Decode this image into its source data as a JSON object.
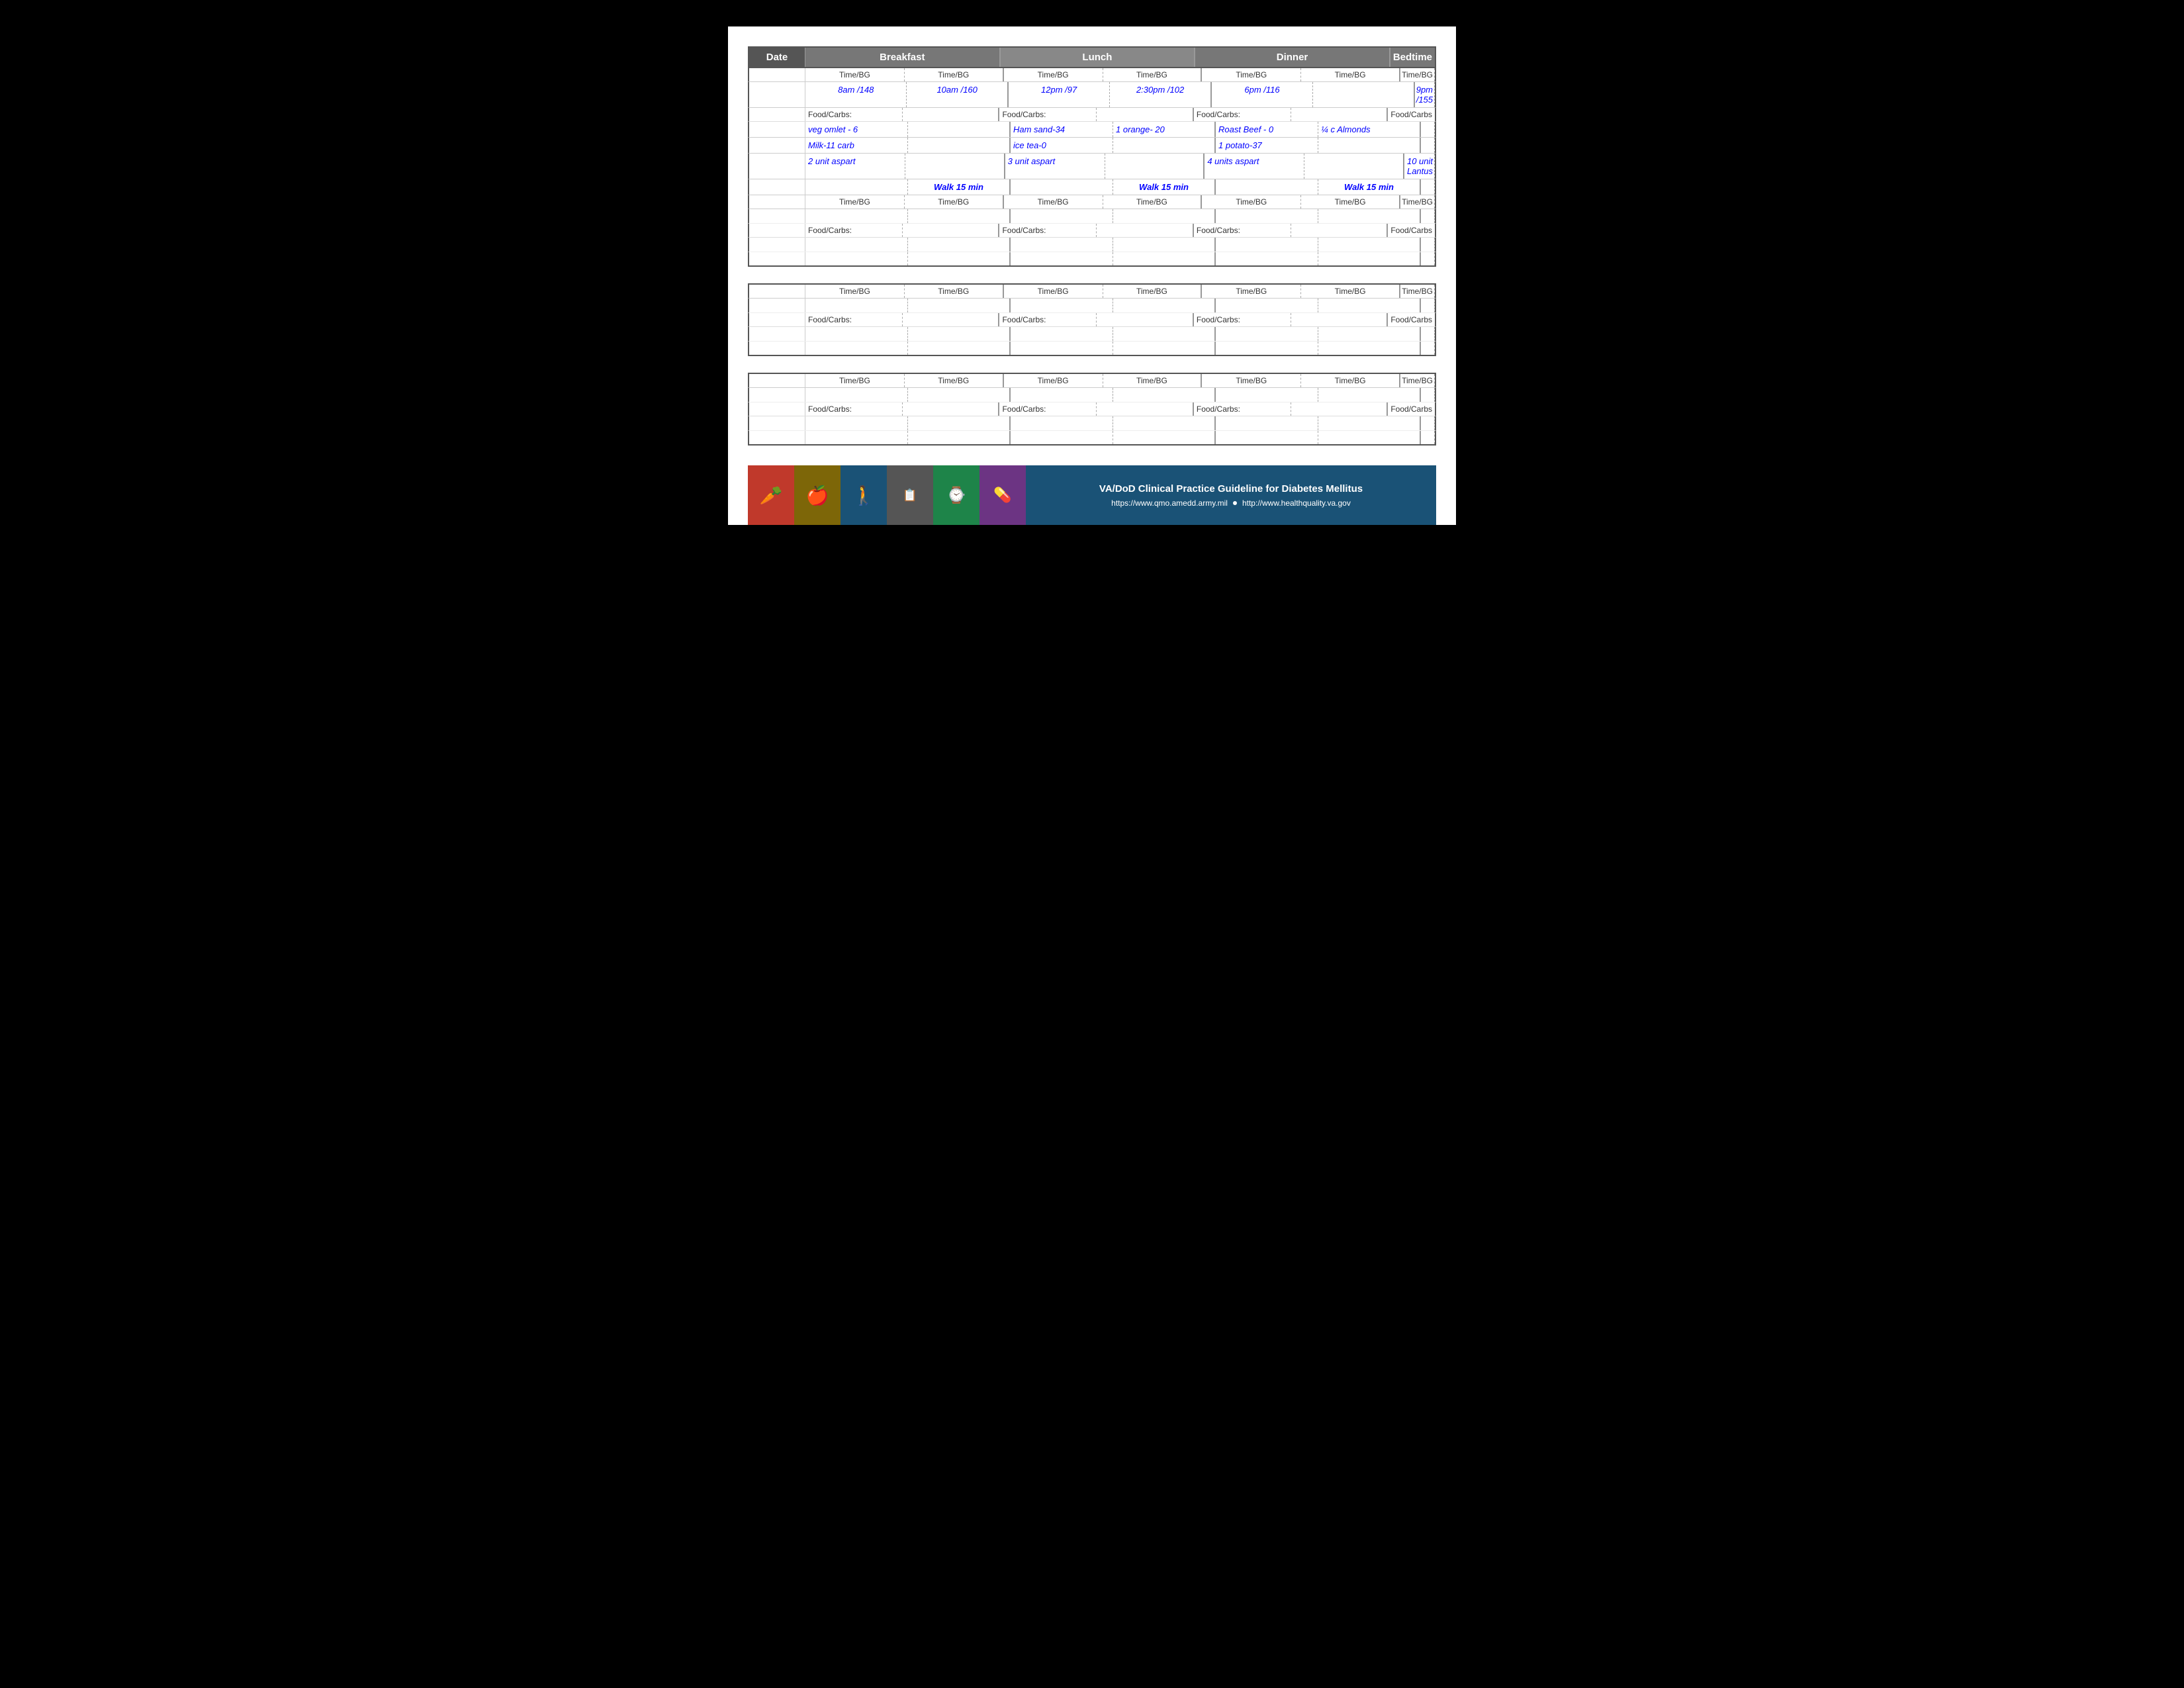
{
  "header": {
    "date_label": "Date",
    "breakfast_label": "Breakfast",
    "lunch_label": "Lunch",
    "dinner_label": "Dinner",
    "bedtime_label": "Bedtime"
  },
  "subheader": {
    "timebg": "Time/BG"
  },
  "row1": {
    "times": [
      "8am /148",
      "10am /160",
      "12pm /97",
      "2:30pm /102",
      "6pm /116",
      "",
      "9pm /155"
    ],
    "food_labels": [
      "Food/Carbs:",
      "",
      "Food/Carbs:",
      "",
      "Food/Carbs:",
      "",
      "Food/Carbs"
    ],
    "food_values": [
      "veg omlet - 6",
      "",
      "Ham sand-34",
      "1 orange- 20",
      "Roast Beef - 0",
      "¼ c Almonds",
      ""
    ],
    "food_values2": [
      "Milk-11 carb",
      "",
      "ice tea-0",
      "",
      "1 potato-37",
      "",
      ""
    ],
    "food_values3": [
      "2 unit aspart",
      "",
      "3 unit aspart",
      "",
      "4 units aspart",
      "",
      "10 unit Lantus"
    ],
    "walk": [
      "",
      "Walk 15 min",
      "",
      "Walk 15 min",
      "",
      "Walk 15 min",
      ""
    ]
  },
  "footer": {
    "title": "VA/DoD Clinical Practice Guideline for Diabetes Mellitus",
    "url1": "https://www.qmo.amedd.army.mil",
    "url2": "http://www.healthquality.va.gov"
  }
}
